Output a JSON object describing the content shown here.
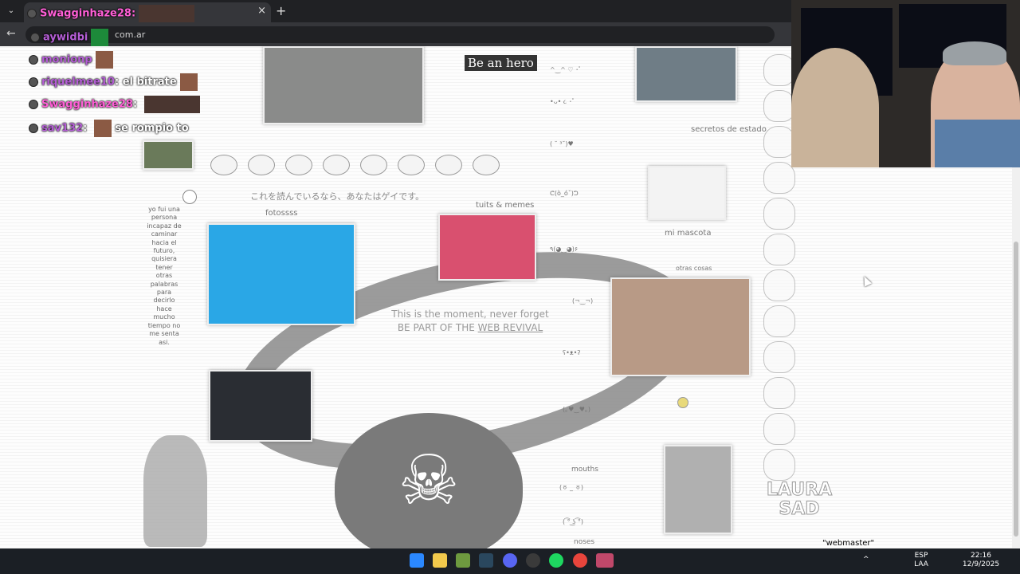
{
  "browser": {
    "tab_label": "Swagginhaze28:",
    "url_fragment": "com.ar",
    "close_glyph": "×",
    "newtab_glyph": "+",
    "back_glyph": "←"
  },
  "chat": [
    {
      "name": "aywidbi",
      "message": ""
    },
    {
      "name": "monionp",
      "message": ""
    },
    {
      "name": "riquelmee10",
      "message": "el bitrate"
    },
    {
      "name": "Swagginhaze28",
      "message": ""
    },
    {
      "name": "sav132",
      "message": "se rompio to"
    }
  ],
  "page": {
    "be_an_hero": "Be an hero",
    "jp_text": "これを読んでいるなら、あなたはゲイです。",
    "fotos_label": "fotossss",
    "tuits_label": "tuits & memes",
    "secretos_label": "secretos de estado",
    "mascota_label": "mi mascota",
    "otras_cosas_label": "otras cosas",
    "mouths_label": "mouths",
    "noses_label": "noses",
    "webmaster_label": "\"webmaster\"",
    "moment_line1": "This is the moment, never forget",
    "moment_line2_prefix": "BE PART OF THE ",
    "moment_link": "WEB REVIVAL",
    "side_text": "yo fui una persona incapaz de caminar hacia el futuro, quisiera tener otras palabras para decirlo hace mucho tiempo no me senta asi.",
    "brand_logo_text": "LAURA SAD",
    "kaomoji": [
      "^‿^ ♡ ･ﾟ",
      "•ᴗ• ૮ ･ﾟ",
      "( ˘ ³˘)♥",
      "ᕦ(ò_óˇ)ᕤ",
      "٩(◕‿◕)۶",
      "(¬‿¬)",
      "ʕ•ᴥ•ʔ",
      "(｡♥‿♥｡)",
      "(ㆆ _ ㆆ)",
      "( ͡° ͜ʖ ͡°)"
    ]
  },
  "taskbar": {
    "lang_top": "ESP",
    "lang_bottom": "LAA",
    "time": "22:16",
    "date": "12/9/2025",
    "caret": "^"
  },
  "colors": {
    "chat_name_purple": "#b55ed6",
    "chat_name_pink": "#ff5fd7",
    "taskbar_bg": "#1b1f25",
    "chrome_dark": "#202124"
  }
}
